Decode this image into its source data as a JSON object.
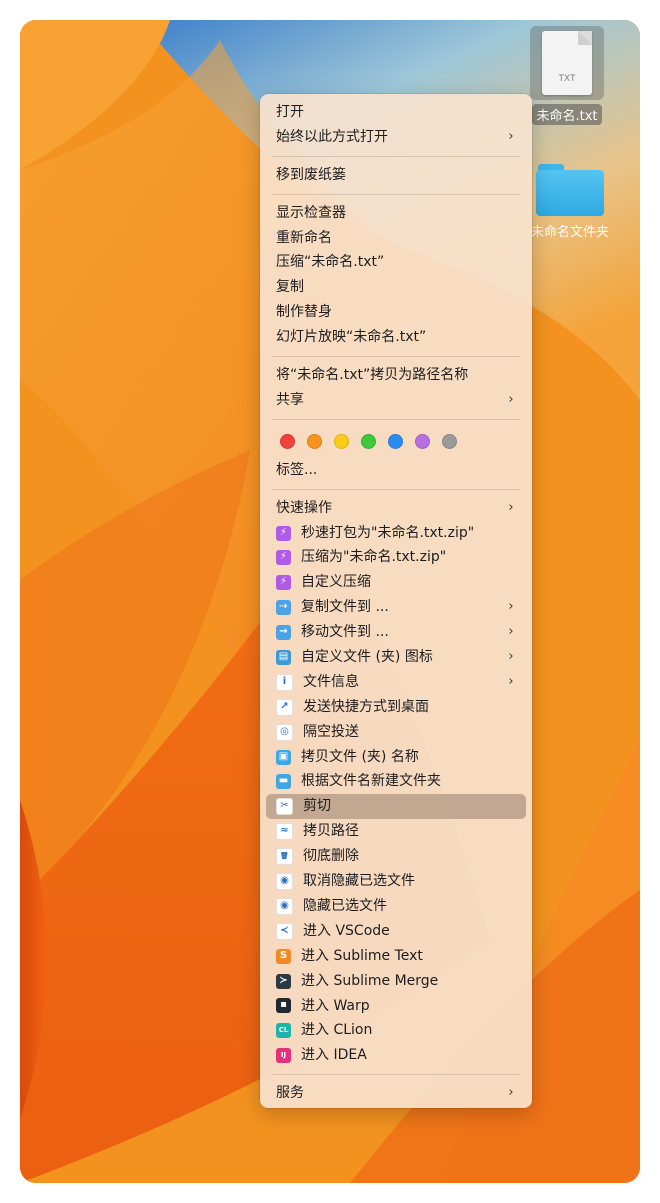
{
  "desktop": {
    "file": {
      "label": "未命名.txt",
      "ext": "TXT"
    },
    "folder": {
      "label": "未命名文件夹"
    }
  },
  "menu": {
    "group1": [
      {
        "label": "打开",
        "submenu": false
      },
      {
        "label": "始终以此方式打开",
        "submenu": true
      }
    ],
    "group2": [
      {
        "label": "移到废纸篓",
        "submenu": false
      }
    ],
    "group3": [
      {
        "label": "显示检查器"
      },
      {
        "label": "重新命名"
      },
      {
        "label": "压缩“未命名.txt”"
      },
      {
        "label": "复制"
      },
      {
        "label": "制作替身"
      },
      {
        "label": "幻灯片放映“未命名.txt”"
      }
    ],
    "group4": [
      {
        "label": "将“未命名.txt”拷贝为路径名称",
        "submenu": false
      },
      {
        "label": "共享",
        "submenu": true
      }
    ],
    "tags": {
      "colors": [
        "#f2423c",
        "#f7941d",
        "#fccb16",
        "#3ec83c",
        "#2a8cf3",
        "#b86ee0",
        "#9a9a9a"
      ],
      "label": "标签..."
    },
    "quick_actions_label": "快速操作",
    "quick_actions": [
      {
        "label": "秒速打包为\"未命名.txt.zip\"",
        "icon": "zip-fast-icon",
        "color": "#b05ae8",
        "glyph": "⚡",
        "submenu": false
      },
      {
        "label": "压缩为\"未命名.txt.zip\"",
        "icon": "compress-icon",
        "color": "#b05ae8",
        "glyph": "⚡",
        "submenu": false
      },
      {
        "label": "自定义压缩",
        "icon": "custom-compress-icon",
        "color": "#b05ae8",
        "glyph": "⚡",
        "submenu": false
      },
      {
        "label": "复制文件到 ...",
        "icon": "copy-file-icon",
        "color": "#4aa3e8",
        "glyph": "⇢",
        "submenu": true
      },
      {
        "label": "移动文件到 ...",
        "icon": "move-file-icon",
        "color": "#4aa3e8",
        "glyph": "→",
        "submenu": true
      },
      {
        "label": "自定义文件 (夹) 图标",
        "icon": "custom-folder-icon",
        "color": "#3a9ad8",
        "glyph": "▤",
        "submenu": true
      },
      {
        "label": "文件信息",
        "icon": "info-icon",
        "color": "#ffffff",
        "glyph": "i",
        "submenu": true
      },
      {
        "label": "发送快捷方式到桌面",
        "icon": "shortcut-arrow-icon",
        "color": "#ffffff",
        "glyph": "↗",
        "submenu": false
      },
      {
        "label": "隔空投送",
        "icon": "airdrop-icon",
        "color": "#ffffff",
        "glyph": "◎",
        "submenu": false
      },
      {
        "label": "拷贝文件 (夹) 名称",
        "icon": "copy-name-icon",
        "color": "#3fa8e0",
        "glyph": "▣",
        "submenu": false
      },
      {
        "label": "根据文件名新建文件夹",
        "icon": "new-folder-icon",
        "color": "#3fa8e0",
        "glyph": "▬",
        "submenu": false
      },
      {
        "label": "剪切",
        "icon": "cut-icon",
        "color": "#ffffff",
        "glyph": "✂",
        "submenu": false,
        "highlight": true
      },
      {
        "label": "拷贝路径",
        "icon": "copy-path-icon",
        "color": "#ffffff",
        "glyph": "≈",
        "submenu": false
      },
      {
        "label": "彻底删除",
        "icon": "trash-icon",
        "color": "#ffffff",
        "glyph": "🗑",
        "submenu": false
      },
      {
        "label": "取消隐藏已选文件",
        "icon": "unhide-eye-icon",
        "color": "#ffffff",
        "glyph": "◉",
        "submenu": false
      },
      {
        "label": "隐藏已选文件",
        "icon": "hide-eye-icon",
        "color": "#ffffff",
        "glyph": "◉",
        "submenu": false
      },
      {
        "label": "进入 VSCode",
        "icon": "vscode-icon",
        "color": "#ffffff",
        "glyph": "≺",
        "submenu": false
      },
      {
        "label": "进入 Sublime Text",
        "icon": "sublime-text-icon",
        "color": "#f08a24",
        "glyph": "S",
        "submenu": false
      },
      {
        "label": "进入 Sublime Merge",
        "icon": "sublime-merge-icon",
        "color": "#2b3a42",
        "glyph": "≻",
        "submenu": false
      },
      {
        "label": "进入 Warp",
        "icon": "warp-icon",
        "color": "#1f2a30",
        "glyph": "▪",
        "submenu": false
      },
      {
        "label": "进入 CLion",
        "icon": "clion-icon",
        "color": "#1fb4a8",
        "glyph": "CL",
        "submenu": false
      },
      {
        "label": "进入 IDEA",
        "icon": "idea-icon",
        "color": "#e0317a",
        "glyph": "IJ",
        "submenu": false
      }
    ],
    "services": {
      "label": "服务",
      "submenu": true
    }
  }
}
